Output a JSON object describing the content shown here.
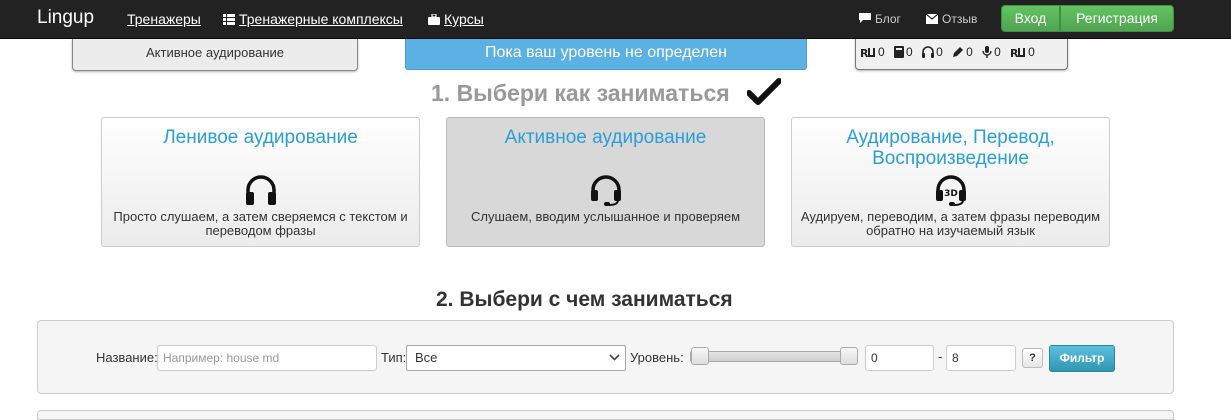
{
  "navbar": {
    "brand": "Lingup",
    "links": [
      "Тренажеры",
      "Тренажерные комплексы",
      "Курсы"
    ],
    "blog": "Блог",
    "feedback": "Отзыв",
    "login": "Вход",
    "register": "Регистрация"
  },
  "top": {
    "active_mode": "Активное аудирование",
    "level_status": "Пока ваш уровень не определен",
    "stats": [
      "0",
      "0",
      "0",
      "0",
      "0",
      "0"
    ]
  },
  "step1": {
    "title": "1. Выбери как заниматься",
    "cards": [
      {
        "title": "Ленивое аудирование",
        "desc": "Просто слушаем, а затем сверяемся с текстом и переводом фразы"
      },
      {
        "title": "Активное аудирование",
        "desc": "Слушаем, вводим услышанное и проверяем"
      },
      {
        "title": "Аудирование, Перевод, Воспроизведение",
        "desc": "Аудируем, переводим, а затем фразы переводим обратно на изучаемый язык",
        "badge": "3D"
      }
    ]
  },
  "step2": {
    "title": "2. Выбери с чем заниматься",
    "filter": {
      "name_label": "Название:",
      "name_placeholder": "Например: house md",
      "type_label": "Тип:",
      "type_value": "Все",
      "level_label": "Уровень:",
      "level_min": "0",
      "level_sep": "-",
      "level_max": "8",
      "help": "?",
      "submit": "Фильтр"
    }
  },
  "colors": {
    "accent": "#2a9fd6",
    "green": "#51a351",
    "info": "#5bb0e4"
  }
}
